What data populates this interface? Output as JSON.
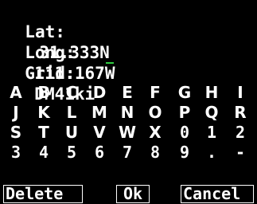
{
  "lat": {
    "label": "Lat:",
    "value": "31.333N"
  },
  "long": {
    "label": "Long:",
    "value_prefix": "111.167",
    "cursor_char": "W"
  },
  "grid": {
    "label": "Grid:",
    "value": "DM41ki"
  },
  "cursor_color": "#2ecc40",
  "keyboard": {
    "rows": [
      [
        "A",
        "B",
        "C",
        "D",
        "E",
        "F",
        "G",
        "H",
        "I"
      ],
      [
        "J",
        "K",
        "L",
        "M",
        "N",
        "O",
        "P",
        "Q",
        "R"
      ],
      [
        "S",
        "T",
        "U",
        "V",
        "W",
        "X",
        "0",
        "1",
        "2"
      ],
      [
        "3",
        "4",
        "5",
        "6",
        "7",
        "8",
        "9",
        ".",
        "-"
      ]
    ]
  },
  "actions": {
    "delete": "Delete",
    "ok": "Ok",
    "cancel": "Cancel"
  }
}
